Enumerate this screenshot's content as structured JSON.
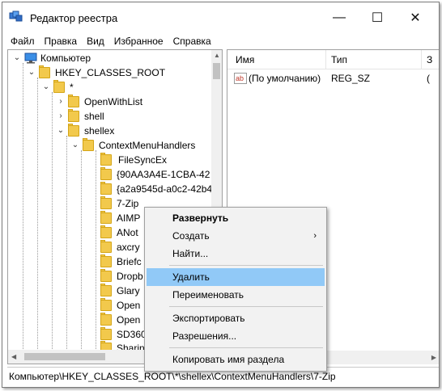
{
  "window": {
    "title": "Редактор реестра",
    "minimize_glyph": "—",
    "maximize_glyph": "☐",
    "close_glyph": "✕"
  },
  "menu": [
    "Файл",
    "Правка",
    "Вид",
    "Избранное",
    "Справка"
  ],
  "tree": {
    "computer": "Компьютер",
    "hkcr": "HKEY_CLASSES_ROOT",
    "star": "*",
    "openwithlist": "OpenWithList",
    "shell": "shell",
    "shellex": "shellex",
    "cmh": "ContextMenuHandlers",
    "children": [
      "FileSyncEx",
      "{90AA3A4E-1CBA-42",
      "{a2a9545d-a0c2-42b4",
      "7-Zip",
      "AIMP",
      "ANot",
      "axcry",
      "Briefc",
      "Dropb",
      "Glary",
      "Open",
      "Open",
      "SD360",
      "Sharin"
    ]
  },
  "right": {
    "col_name": "Имя",
    "col_type": "Тип",
    "col_data": "З",
    "rows": [
      {
        "name": "(По умолчанию)",
        "type": "REG_SZ",
        "data": "("
      }
    ]
  },
  "context_menu": {
    "items": [
      {
        "label": "Развернуть",
        "bold": true
      },
      {
        "label": "Создать",
        "submenu": true
      },
      {
        "label": "Найти..."
      },
      {
        "label": "Удалить",
        "highlighted": true
      },
      {
        "label": "Переименовать"
      },
      {
        "label": "Экспортировать"
      },
      {
        "label": "Разрешения..."
      },
      {
        "label": "Копировать имя раздела"
      }
    ]
  },
  "status": "Компьютер\\HKEY_CLASSES_ROOT\\*\\shellex\\ContextMenuHandlers\\7-Zip",
  "icons": {
    "computer": "computer-icon",
    "folder": "folder-icon",
    "string_value": "string-value-icon",
    "submenu_arrow": "›"
  },
  "colors": {
    "folder": "#f2c94c",
    "highlight": "#91c9f7",
    "value_icon_red": "#c0392b"
  }
}
